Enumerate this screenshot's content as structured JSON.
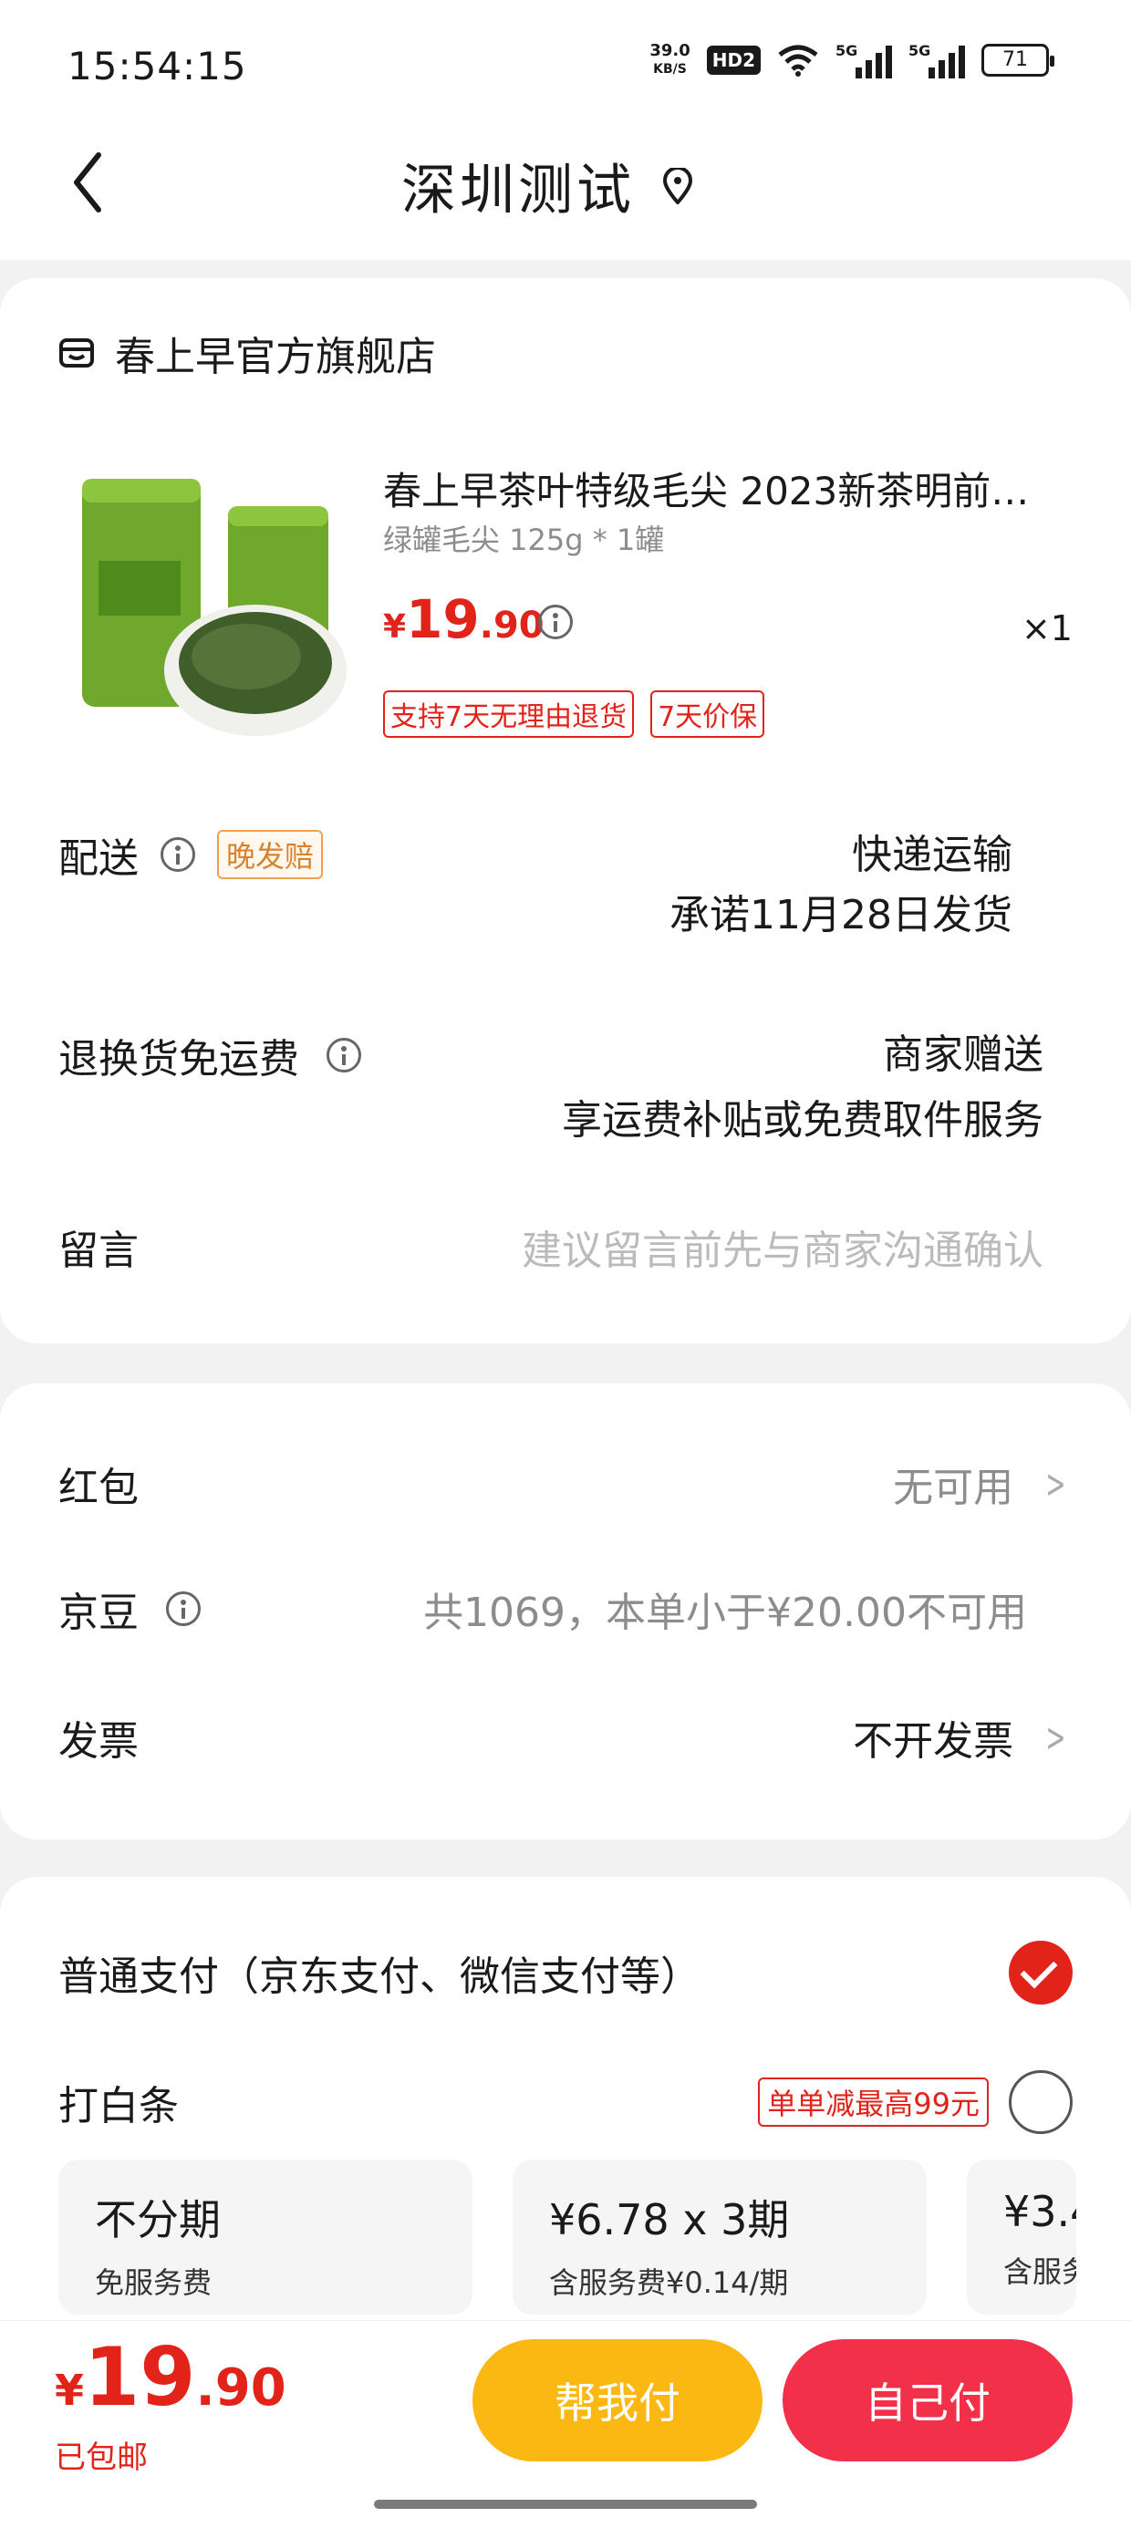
{
  "status_bar": {
    "time": "15:54:15",
    "net_speed_value": "39.0",
    "net_speed_unit": "KB/S",
    "hd": "HD2",
    "signal_1": "5G",
    "signal_2": "5G",
    "battery": "71"
  },
  "nav": {
    "title": "深圳测试"
  },
  "order": {
    "shop_name": "春上早官方旗舰店",
    "product_title": "春上早茶叶特级毛尖 2023新茶明前…",
    "product_spec": "绿罐毛尖 125g * 1罐",
    "price_currency": "¥",
    "price_int": "19",
    "price_dec": ".90",
    "quantity": "×1",
    "tags": [
      "支持7天无理由退货",
      "7天价保"
    ],
    "delivery_label": "配送",
    "delivery_tag": "晚发赔",
    "delivery_method": "快递运输",
    "delivery_promise": "承诺11月28日发货",
    "return_label": "退换货免运费",
    "return_value": "商家赠送",
    "return_desc": "享运费补贴或免费取件服务",
    "message_label": "留言",
    "message_placeholder": "建议留言前先与商家沟通确认"
  },
  "benefits": {
    "redpacket_label": "红包",
    "redpacket_value": "无可用",
    "jingdou_label": "京豆",
    "jingdou_value": "共1069，本单小于¥20.00不可用",
    "invoice_label": "发票",
    "invoice_value": "不开发票"
  },
  "payment": {
    "normal_label": "普通支付（京东支付、微信支付等）",
    "baitiao_label": "打白条",
    "baitiao_promo": "单单减最高99元",
    "plans": [
      {
        "title": "不分期",
        "sub": "免服务费"
      },
      {
        "title": "¥6.78 x 3期",
        "sub": "含服务费¥0.14/期"
      },
      {
        "title": "¥3.4",
        "sub": "含服务费"
      }
    ]
  },
  "bottom": {
    "total_currency": "¥",
    "total_int": "19",
    "total_dec": ".90",
    "shipping": "已包邮",
    "help_pay": "帮我付",
    "self_pay": "自己付"
  },
  "colors": {
    "accent_red": "#e2231a",
    "help_button": "#fbb812",
    "self_button": "#f2304a"
  }
}
